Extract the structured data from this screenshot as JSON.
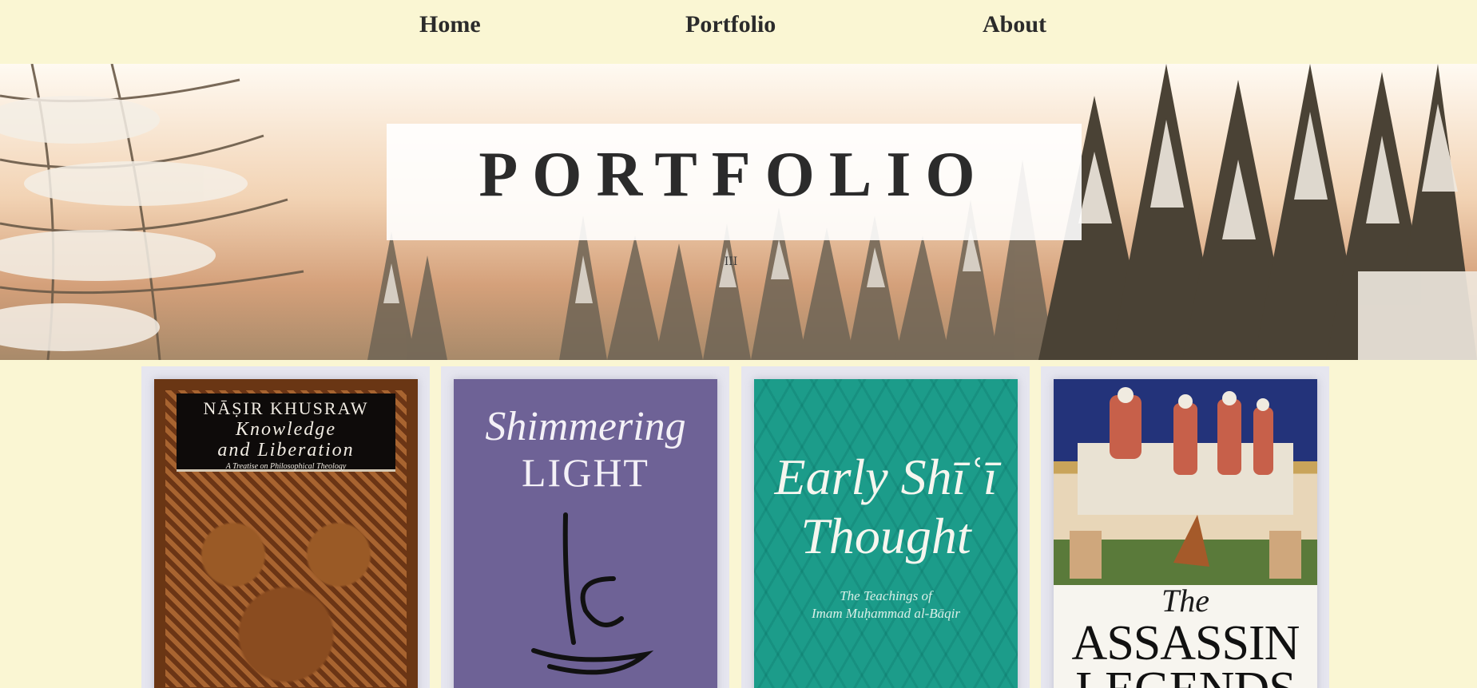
{
  "nav": {
    "items": [
      {
        "label": "Home"
      },
      {
        "label": "Portfolio"
      },
      {
        "label": "About"
      }
    ]
  },
  "hero": {
    "title": "PORTFOLIO",
    "mark": "III"
  },
  "books": [
    {
      "author": "NĀṢIR KHUSRAW",
      "title_line1": "Knowledge",
      "title_line2": "and Liberation",
      "subtitle": "A Treatise on Philosophical Theology"
    },
    {
      "title_line1": "Shimmering",
      "title_line2": "LIGHT",
      "calligraphy": "علي"
    },
    {
      "title_line1": "Early Shīʿī",
      "title_line2": "Thought",
      "subtitle_line1": "The Teachings of",
      "subtitle_line2": "Imam Muḥammad al-Bāqir"
    },
    {
      "title_line1": "The",
      "title_line2": "ASSASSIN",
      "title_line3": "LEGENDS"
    }
  ],
  "colors": {
    "page_background": "#faf6d3",
    "text": "#2b2b2b",
    "card_background": "#e6e6ef"
  }
}
